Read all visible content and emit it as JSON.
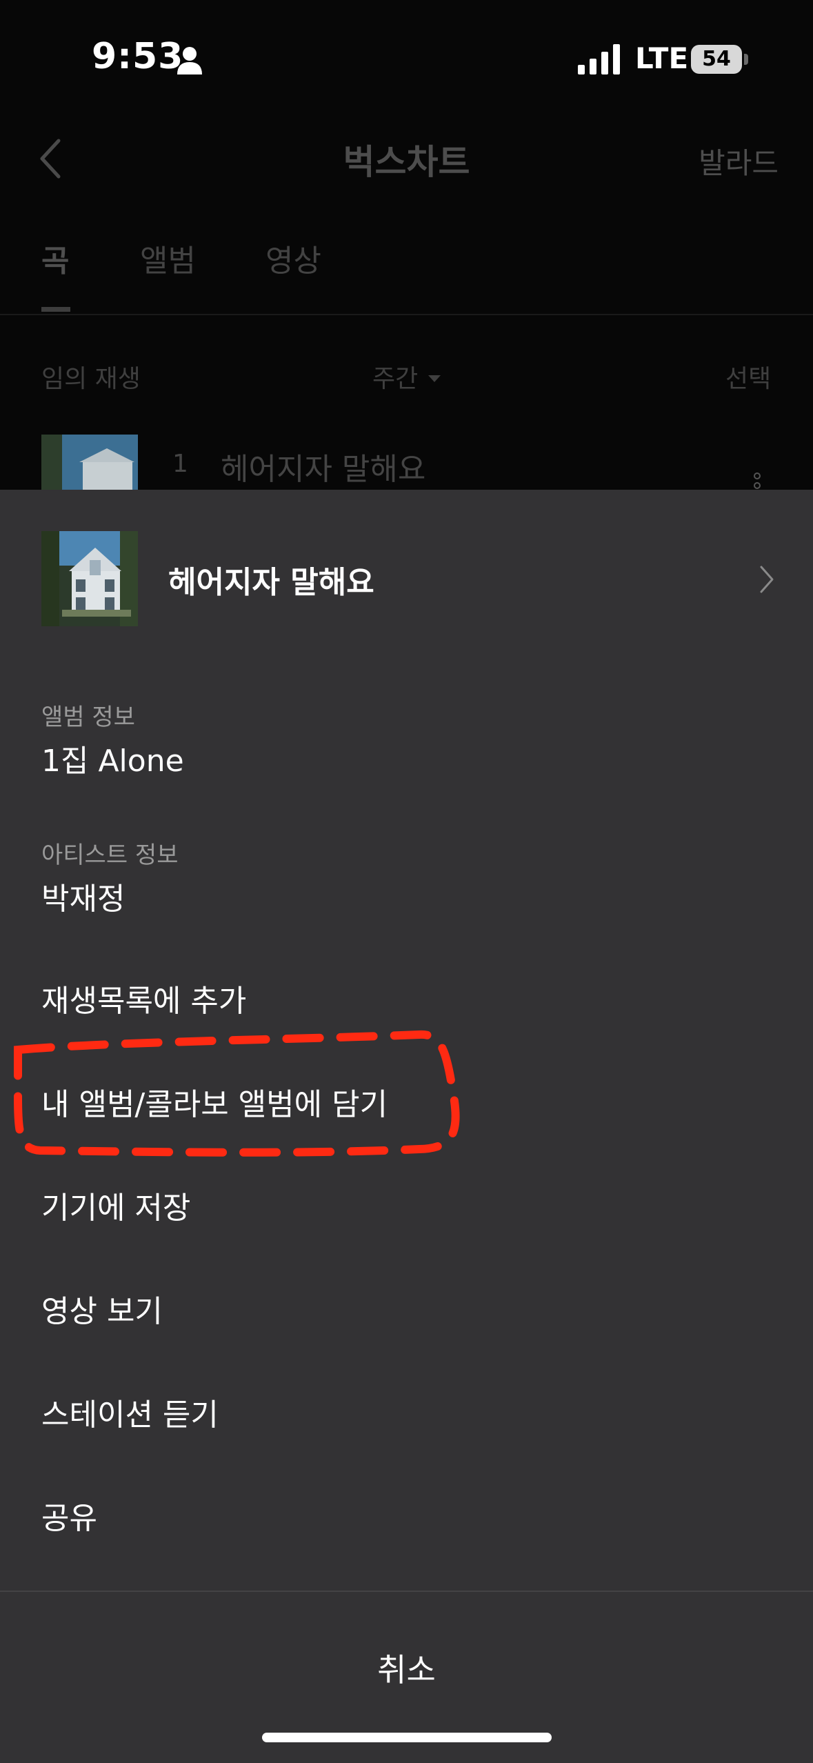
{
  "status_bar": {
    "time": "9:53",
    "network": "LTE",
    "battery": "54"
  },
  "nav": {
    "title": "벅스차트",
    "right_label": "발라드"
  },
  "tabs": [
    {
      "label": "곡",
      "active": true
    },
    {
      "label": "앨범",
      "active": false
    },
    {
      "label": "영상",
      "active": false
    }
  ],
  "toolbar": {
    "shuffle_label": "임의 재생",
    "period_label": "주간",
    "select_label": "선택"
  },
  "chart_list": [
    {
      "rank": "1",
      "title": "헤어지자 말해요"
    }
  ],
  "sheet": {
    "song_title": "헤어지자 말해요",
    "album_caption": "앨범 정보",
    "album_value": "1집 Alone",
    "artist_caption": "아티스트 정보",
    "artist_value": "박재정",
    "menu": [
      "재생목록에 추가",
      "내 앨범/콜라보 앨범에 담기",
      "기기에 저장",
      "영상 보기",
      "스테이션 듣기",
      "공유"
    ],
    "cancel_label": "취소"
  },
  "colors": {
    "sheet_bg": "#333234",
    "page_bg": "#070707",
    "annotation_red": "#ff2a12"
  }
}
